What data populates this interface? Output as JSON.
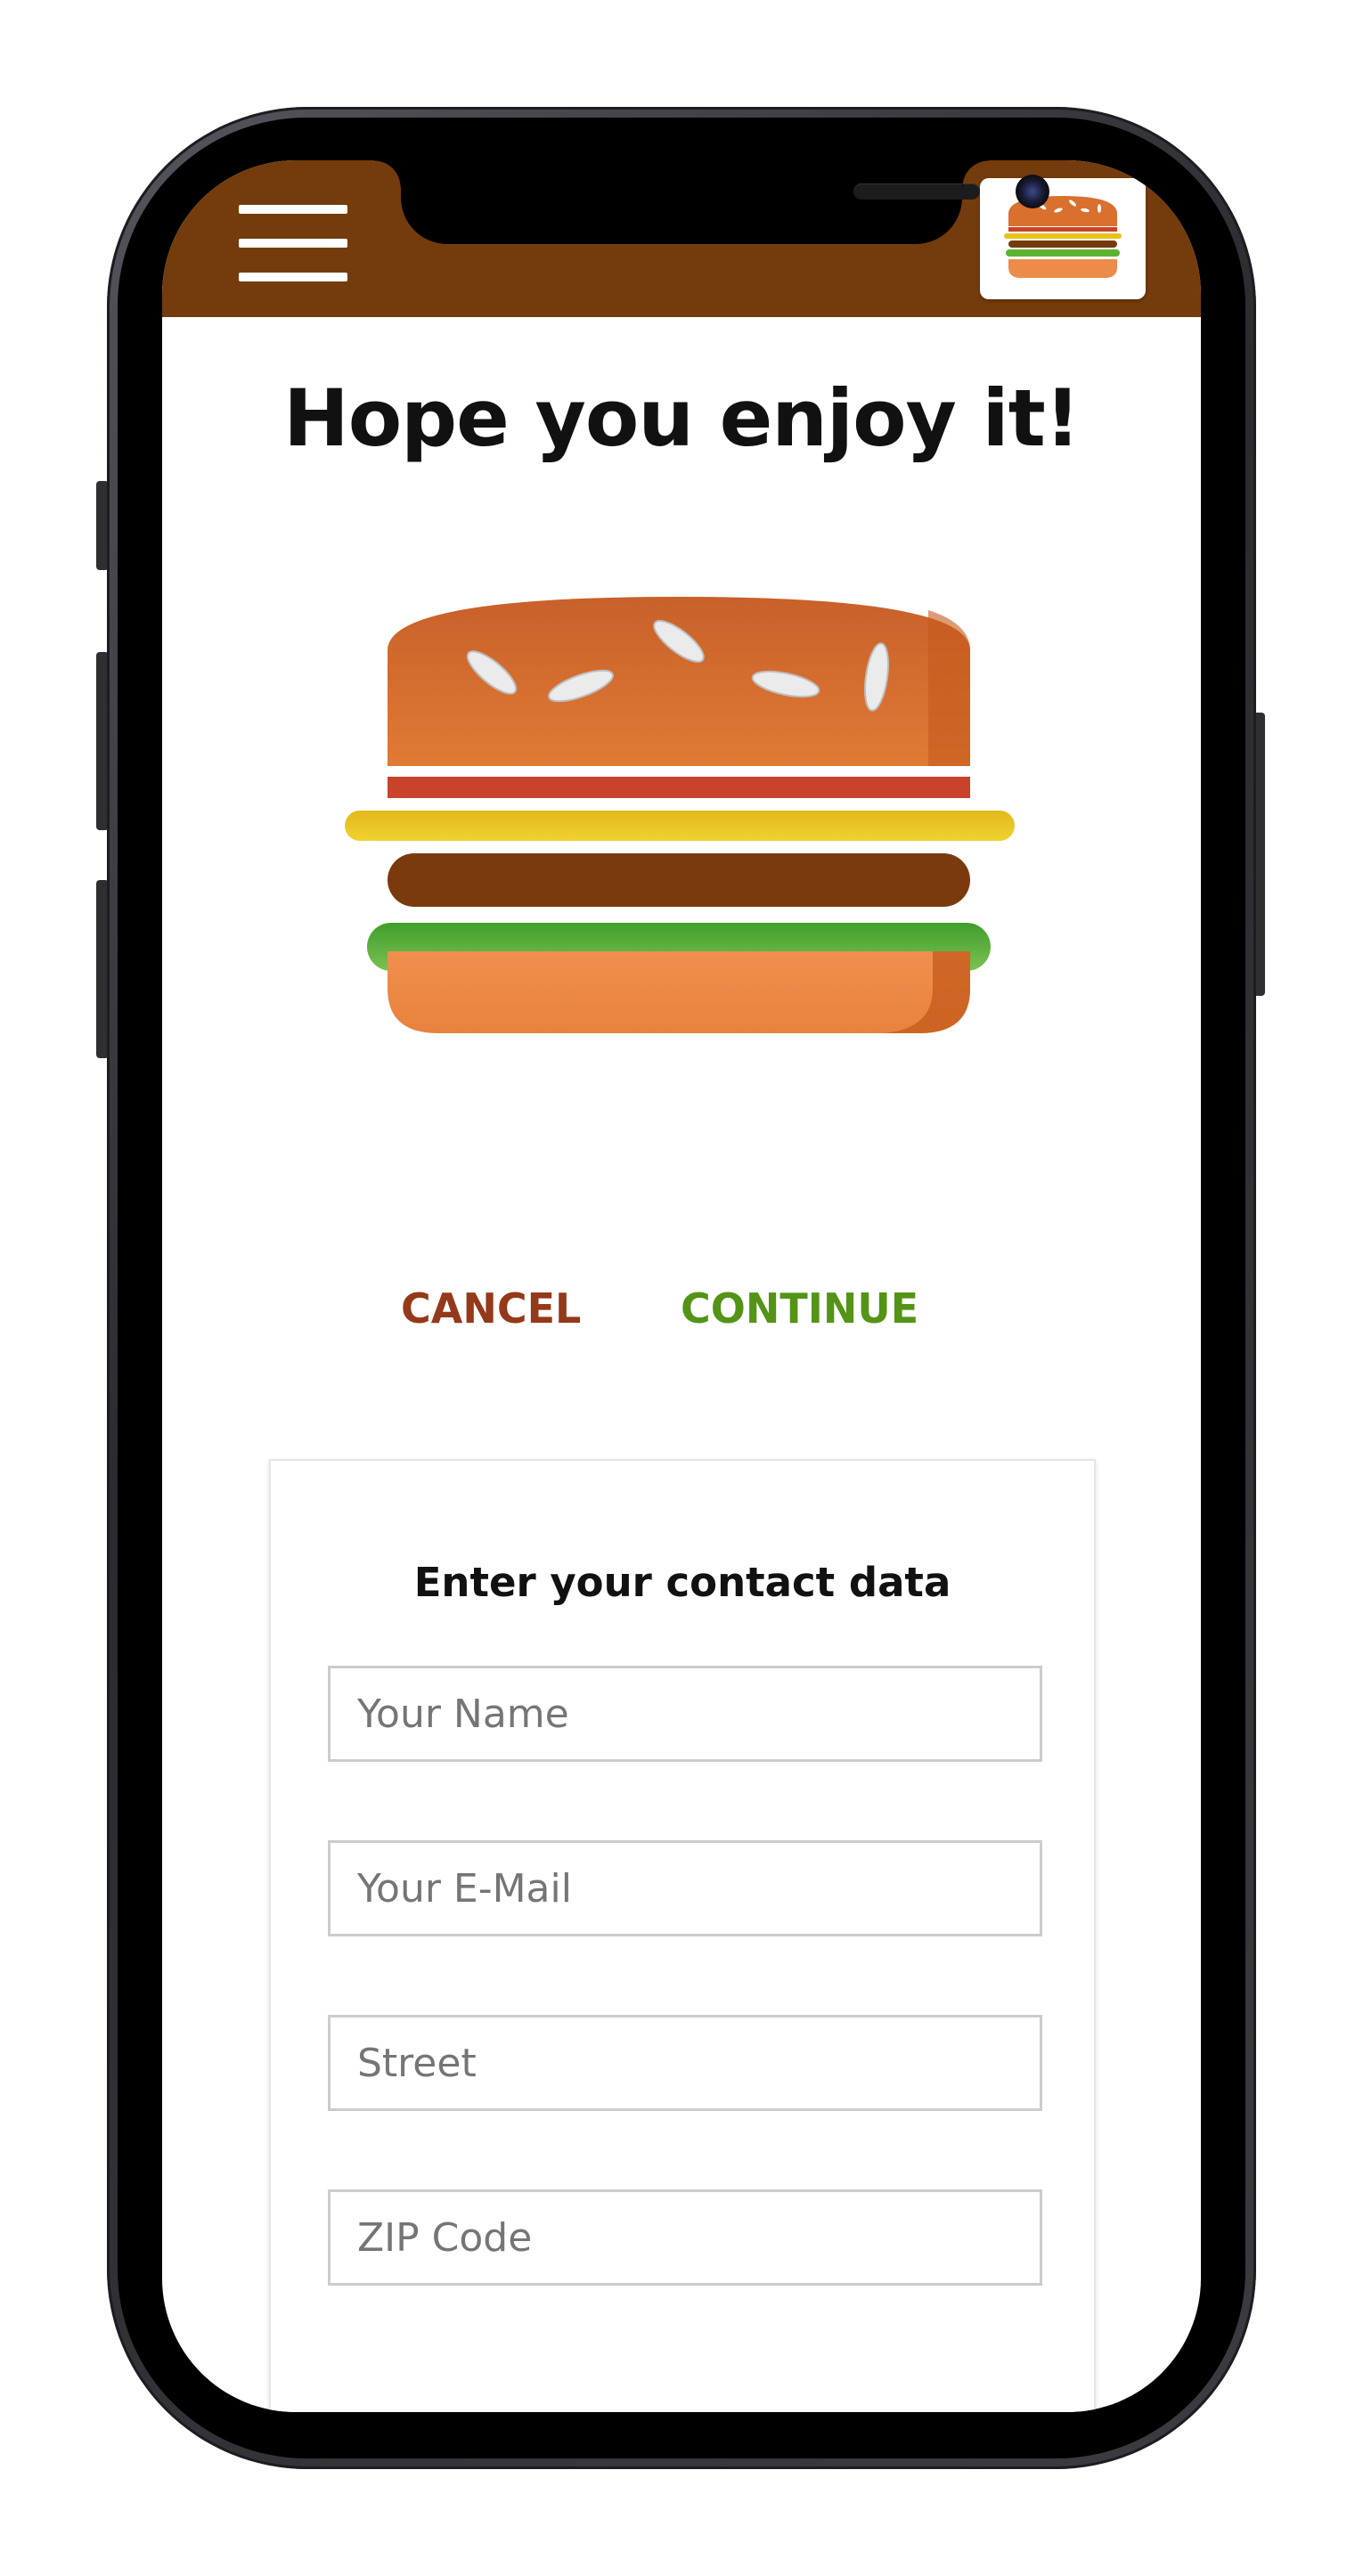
{
  "header": {
    "menu_icon": "hamburger-menu-icon",
    "logo_icon": "burger-logo-icon",
    "background_color": "#743c0c"
  },
  "main": {
    "title": "Hope you enjoy it!",
    "illustration_icon": "burger-icon"
  },
  "actions": {
    "cancel_label": "CANCEL",
    "continue_label": "CONTINUE",
    "cancel_color": "#94391a",
    "continue_color": "#539417"
  },
  "contact_form": {
    "title": "Enter your contact data",
    "fields": [
      {
        "placeholder": "Your Name",
        "value": ""
      },
      {
        "placeholder": "Your E-Mail",
        "value": ""
      },
      {
        "placeholder": "Street",
        "value": ""
      },
      {
        "placeholder": "ZIP Code",
        "value": ""
      }
    ]
  }
}
